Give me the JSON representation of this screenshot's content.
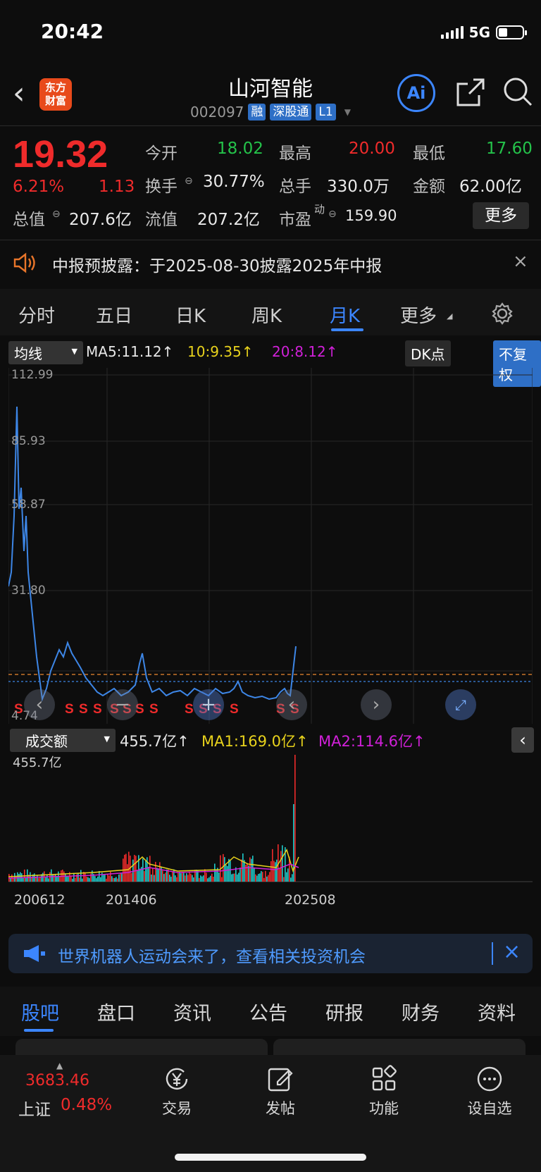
{
  "status": {
    "time": "20:42",
    "network": "5G"
  },
  "header": {
    "logo_text_top": "东方",
    "logo_text_bottom": "财富",
    "stock_name": "山河智能",
    "stock_code": "002097",
    "tags": [
      "融",
      "深股通",
      "L1"
    ],
    "ai_label": "Ai"
  },
  "quote": {
    "price": "19.32",
    "pct_change": "6.21%",
    "change": "1.13",
    "open_label": "今开",
    "open": "18.02",
    "high_label": "最高",
    "high": "20.00",
    "low_label": "最低",
    "low": "17.60",
    "turnover_label": "换手",
    "turnover": "30.77%",
    "volume_label": "总手",
    "volume": "330.0万",
    "amount_label": "金额",
    "amount": "62.00亿",
    "mktcap_label": "总值",
    "mktcap": "207.6亿",
    "float_label": "流值",
    "float_cap": "207.2亿",
    "pe_label": "市盈",
    "pe_sup": "动",
    "pe": "159.90",
    "more_label": "更多"
  },
  "notice": {
    "text": "中报预披露：于2025-08-30披露2025年中报"
  },
  "tabs": [
    "分时",
    "五日",
    "日K",
    "周K",
    "月K",
    "更多"
  ],
  "active_tab": "月K",
  "ma_bar": {
    "indicator": "均线",
    "ma5": "MA5:11.12↑",
    "ma10": "10:9.35↑",
    "ma20": "20:8.12↑",
    "dk_label": "DK点",
    "adj_label": "不复权"
  },
  "price_chart": {
    "y_ticks": [
      "112.99",
      "85.93",
      "58.87",
      "31.80",
      "4.74"
    ],
    "marker": "S",
    "colors": {
      "line": "#3d86e6",
      "red": "#ef2b2b",
      "ma10": "#e8d21c",
      "ma20": "#d020d8",
      "dash": "#c8742a"
    }
  },
  "vol_bar": {
    "indicator": "成交额",
    "value": "455.7亿↑",
    "ma1": "MA1:169.0亿↑",
    "ma2": "MA2:114.6亿↑",
    "top_label": "455.7亿"
  },
  "x_ticks": [
    "200612",
    "201406",
    "202508"
  ],
  "banner": {
    "text": "世界机器人运动会来了，查看相关投资机会"
  },
  "bottom_tabs": [
    "股吧",
    "盘口",
    "资讯",
    "公告",
    "研报",
    "财务",
    "资料"
  ],
  "active_bottom_tab": "股吧",
  "bottom_nav": {
    "index_value": "3683.46",
    "index_name": "上证",
    "index_pct": "0.48%",
    "items": [
      "交易",
      "发帖",
      "功能",
      "设自选"
    ]
  }
}
